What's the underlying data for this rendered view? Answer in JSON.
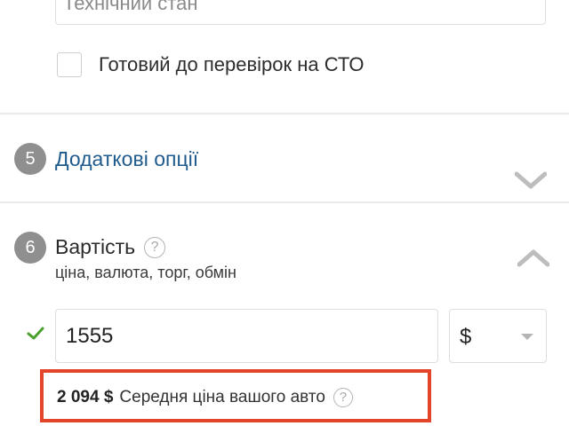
{
  "technical_state": {
    "placeholder": "Технічний стан"
  },
  "sto_checkbox": {
    "label": "Готовий до перевірок на СТО",
    "checked": false
  },
  "section5": {
    "number": "5",
    "title": "Додаткові опції",
    "expanded": false
  },
  "section6": {
    "number": "6",
    "title": "Вартість",
    "subtitle": "ціна, валюта, торг, обмін",
    "help_glyph": "?",
    "expanded": true
  },
  "price": {
    "value": "1555",
    "valid": true
  },
  "currency": {
    "selected": "$"
  },
  "average_price": {
    "amount": "2 094 $",
    "label": "Середня ціна вашого авто",
    "help_glyph": "?"
  },
  "colors": {
    "link": "#1f5b8c",
    "step_badge": "#8f8f8f",
    "check": "#4aa02c",
    "highlight_border": "#e3452b"
  }
}
